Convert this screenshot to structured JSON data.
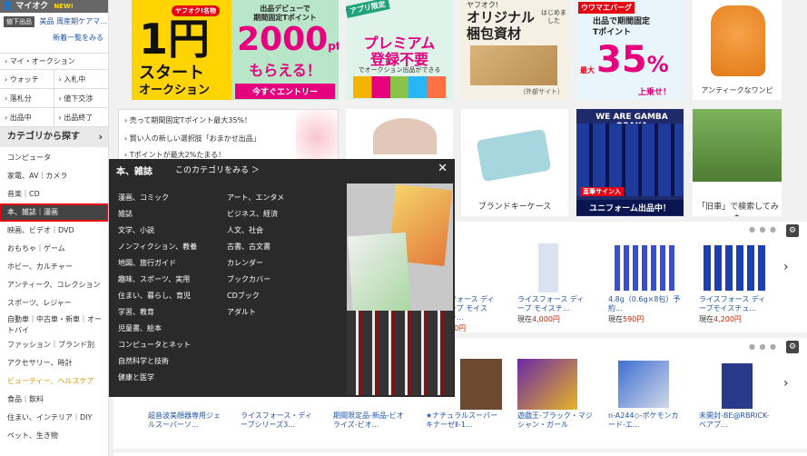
{
  "sidebar": {
    "my_title": "マイオク",
    "my_new": "NEW!",
    "drop_badge": "値下出品",
    "drop_item": "美品 周産期ケアマ...",
    "new_list": "新着一覧をみる",
    "my_auction": "マイ・オークション",
    "grid": [
      "ウォッチ",
      "入札中",
      "落札分",
      "値下交渉",
      "出品中",
      "出品終了"
    ],
    "cat_head": "カテゴリから探す",
    "categories": [
      "コンピュータ",
      "家電、AV｜カメラ",
      "音楽｜CD",
      "本、雑誌｜漫画",
      "映画、ビデオ｜DVD",
      "おもちゃ｜ゲーム",
      "ホビー、カルチャー",
      "アンティーク、コレクション",
      "スポーツ、レジャー",
      "自動車｜中古車・新車｜オートバイ",
      "ファッション｜ブランド別",
      "アクセサリー、時計",
      "ビューティー、ヘルスケア",
      "食品｜飲料",
      "住まい、インテリア｜DIY",
      "ペット、生き物"
    ]
  },
  "banners": {
    "b1_top": "ヤフオク!名物",
    "b1_main": "1円",
    "b1_sub": "スタート",
    "b1_sub2": "オークション",
    "b2_top": "出品デビューで",
    "b2_top2": "期間固定Tポイント",
    "b2_main": "2000",
    "b2_pt": "pt",
    "b2_sub": "もらえる！",
    "b2_btn": "今すぐエントリー",
    "b3_tag": "アプリ限定",
    "b3_main": "プレミアム",
    "b3_main2": "登録不要",
    "b3_sub": "でオークション出品ができる",
    "b4_top": "ヤフオク!",
    "b4_main": "オリジナル",
    "b4_main2": "梱包資材",
    "b4_side": "はじめました",
    "b4_foot": "（外部サイト）",
    "b5_tag": "ウワマエバーグ",
    "b5_top": "出品で期間固定",
    "b5_top2": "Tポイント",
    "b5_max": "最大",
    "b5_main": "35",
    "b5_pct": "%",
    "b5_sub": "上乗せ！",
    "b6_label": "アンティークなワンピ"
  },
  "news": [
    "売って期間固定Tポイント最大35%！",
    "賢い人の新しい選択肢「おまかせ出品」",
    "Tポイントが最大2%たまる！"
  ],
  "tiles": {
    "key_case": "ブランドキーケース",
    "uniform_banner": "WE ARE GAMBA OSAKA",
    "uniform_tag": "直筆サイン入",
    "uniform_label": "ユニフォーム出品中！",
    "old_car": "「旧車」で検索してみた"
  },
  "popup": {
    "title": "本、雑誌",
    "view_all": "このカテゴリをみる ＞",
    "col1": [
      "漫画、コミック",
      "雑誌",
      "文学、小説",
      "ノンフィクション、教養",
      "地図、旅行ガイド",
      "趣味、スポーツ、実用",
      "住まい、暮らし、育児",
      "学習、教育",
      "児童書、絵本",
      "コンピュータとネット",
      "自然科学と技術",
      "健康と医学"
    ],
    "col2": [
      "アート、エンタメ",
      "ビジネス、経済",
      "人文、社会",
      "古書、古文書",
      "カレンダー",
      "ブックカバー",
      "CDブック",
      "アダルト"
    ],
    "close": "✕"
  },
  "row1": [
    {
      "title": "フォース ディープ モイスチ...",
      "price_label": "",
      "price": "00円"
    },
    {
      "title": "ライスフォース ディープ モイスチ...",
      "price_label": "現在",
      "price": "4,000円"
    },
    {
      "title": "4.8g（0.6g×8包）予約...",
      "price_label": "現在",
      "price": "590円"
    },
    {
      "title": "ライスフォース ディープモイスチュ...",
      "price_label": "現在",
      "price": "4,200円"
    }
  ],
  "row2": [
    {
      "title": "超音波美顔器専用ジェルスーパーソ..."
    },
    {
      "title": "ライスフォース・ディープシリーズ3..."
    },
    {
      "title": "期間限定品-新品-ビオライズ-ビオ..."
    },
    {
      "title": "★ナチュラルスーパーキナーゼⅡ-1..."
    },
    {
      "title": "遊戯王-ブラック・マジシャン・ガール"
    },
    {
      "title": "n-A244◇-ポケモンカード-エ..."
    },
    {
      "title": "未開封-BE@RBRICK-ベアブ..."
    }
  ],
  "colors": {
    "accent": "#e60012",
    "link": "#2255aa",
    "price": "#cc2200"
  }
}
